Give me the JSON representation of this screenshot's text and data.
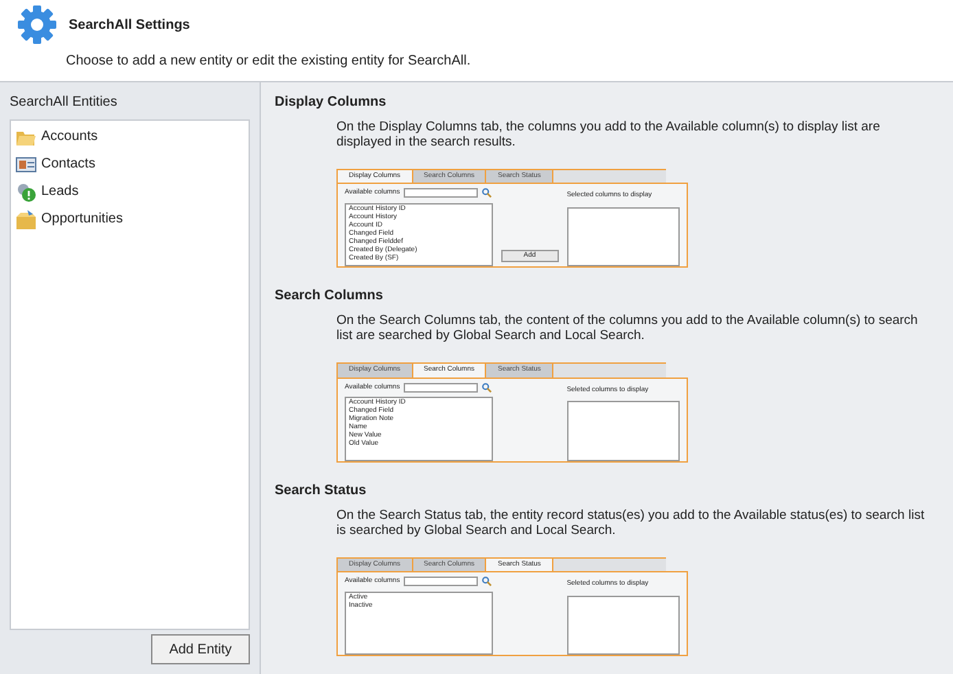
{
  "header": {
    "title": "SearchAll Settings",
    "subtitle": "Choose to add a new entity or edit the existing entity for SearchAll."
  },
  "sidebar": {
    "title": "SearchAll Entities",
    "items": [
      {
        "label": "Accounts",
        "kind": "folder"
      },
      {
        "label": "Contacts",
        "kind": "card"
      },
      {
        "label": "Leads",
        "kind": "lead"
      },
      {
        "label": "Opportunities",
        "kind": "box"
      }
    ],
    "button": "Add Entity"
  },
  "sections": [
    {
      "title": "Display Columns",
      "description": "On the Display Columns tab, the columns you add to the Available column(s) to display list are displayed in the search results.",
      "preview": {
        "tabs": [
          {
            "label": "Display Columns",
            "selected": true
          },
          {
            "label": "Search Columns",
            "selected": false
          },
          {
            "label": "Search Status",
            "selected": false
          }
        ],
        "available_label": "Available columns",
        "items": [
          "Account History ID",
          "Account History",
          "Account ID",
          "Changed Field",
          "Changed Fielddef",
          "Created By (Delegate)",
          "Created By (SF)"
        ],
        "add_button": "Add",
        "selected_label": "Selected columns to display"
      }
    },
    {
      "title": "Search Columns",
      "description": "On the Search Columns tab, the content of the columns you add to the Available column(s) to search list are searched by Global Search and Local Search.",
      "preview": {
        "tabs": [
          {
            "label": "Display Columns",
            "selected": false
          },
          {
            "label": "Search Columns",
            "selected": true
          },
          {
            "label": "Search Status",
            "selected": false
          }
        ],
        "available_label": "Available columns",
        "items": [
          "Account History ID",
          "Changed Field",
          "Migration Note",
          "Name",
          "New Value",
          "Old Value"
        ],
        "selected_label": "Seleted columns to display"
      }
    },
    {
      "title": "Search Status",
      "description": "On the Search Status tab, the entity record status(es) you add to the Available status(es) to search list is searched by Global Search and Local Search.",
      "preview": {
        "tabs": [
          {
            "label": "Display Columns",
            "selected": false
          },
          {
            "label": "Search Columns",
            "selected": false
          },
          {
            "label": "Search Status",
            "selected": true
          }
        ],
        "available_label": "Available columns",
        "items": [
          "Active",
          "Inactive"
        ],
        "selected_label": "Seleted columns to display"
      }
    }
  ]
}
